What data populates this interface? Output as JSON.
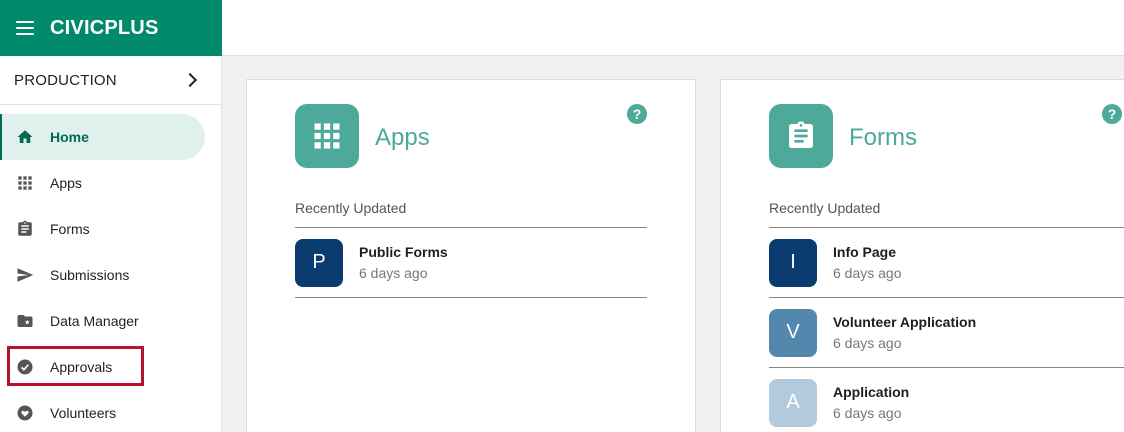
{
  "header": {
    "brand": "CIVICPLUS",
    "brand_color": "#008a6b"
  },
  "sidebar": {
    "environment": "PRODUCTION",
    "items": [
      {
        "label": "Home",
        "icon": "home-icon",
        "active": true
      },
      {
        "label": "Apps",
        "icon": "grid-icon"
      },
      {
        "label": "Forms",
        "icon": "clipboard-icon"
      },
      {
        "label": "Submissions",
        "icon": "send-icon"
      },
      {
        "label": "Data Manager",
        "icon": "folder-star-icon"
      },
      {
        "label": "Approvals",
        "icon": "check-circle-icon",
        "highlighted": true
      },
      {
        "label": "Volunteers",
        "icon": "heart-hand-icon"
      }
    ]
  },
  "apps_card": {
    "title": "Apps",
    "help": "?",
    "recent_label": "Recently Updated",
    "items": [
      {
        "letter": "P",
        "name": "Public Forms",
        "updated": "6 days ago",
        "color": "#0b3c6f"
      }
    ]
  },
  "forms_card": {
    "title": "Forms",
    "help": "?",
    "recent_label": "Recently Updated",
    "items": [
      {
        "letter": "I",
        "name": "Info Page",
        "updated": "6 days ago",
        "color": "#0b3c6f"
      },
      {
        "letter": "V",
        "name": "Volunteer Application",
        "updated": "6 days ago",
        "color": "#5387ad"
      },
      {
        "letter": "A",
        "name": "Application",
        "updated": "6 days ago",
        "color": "#b2cadb"
      }
    ]
  },
  "colors": {
    "accent": "#4da99a",
    "highlight": "#b5122b"
  }
}
